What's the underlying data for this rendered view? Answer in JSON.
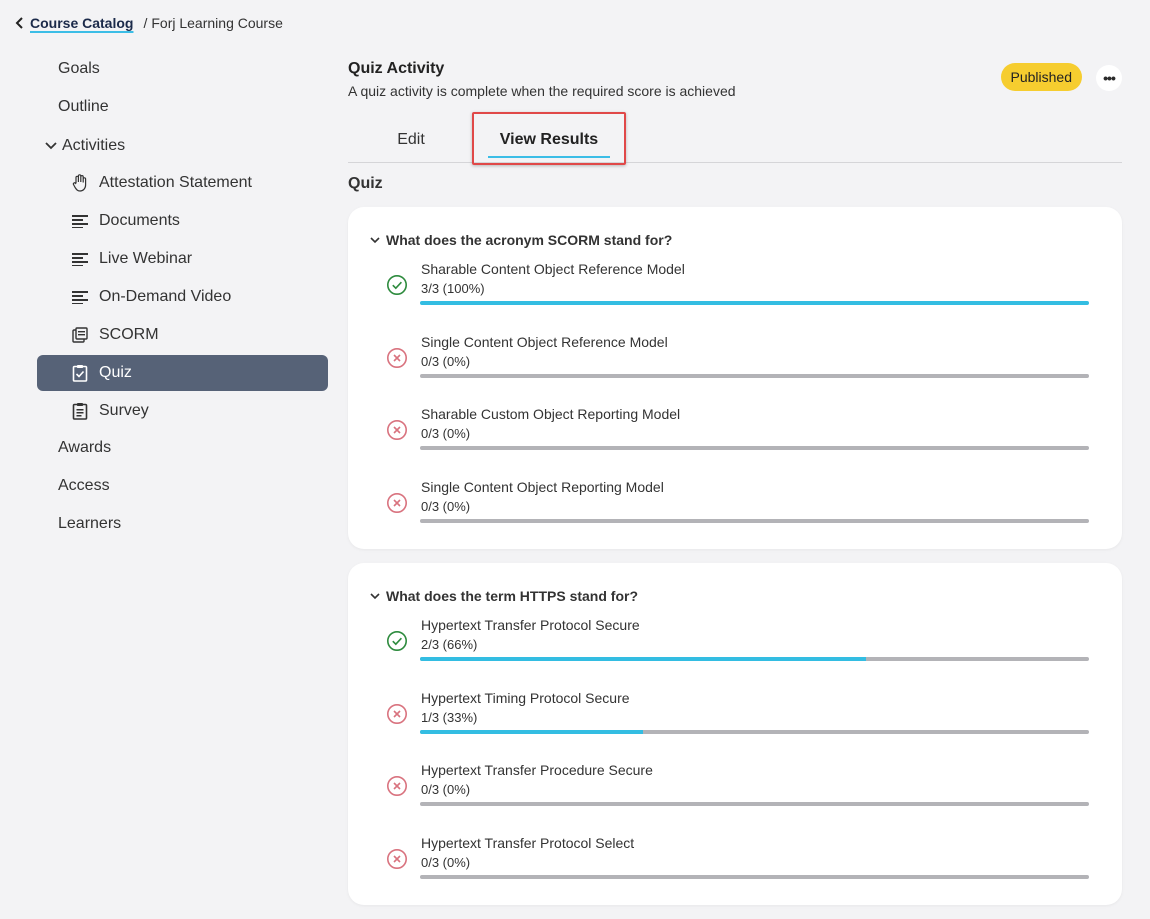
{
  "breadcrumb": {
    "link": "Course Catalog",
    "separator": "/",
    "current": "Forj Learning Course"
  },
  "sidebar": {
    "top": [
      {
        "label": "Goals"
      },
      {
        "label": "Outline"
      }
    ],
    "group": {
      "label": "Activities"
    },
    "activities": [
      {
        "label": "Attestation Statement",
        "icon": "hand-icon"
      },
      {
        "label": "Documents",
        "icon": "lines-icon"
      },
      {
        "label": "Live Webinar",
        "icon": "lines-icon"
      },
      {
        "label": "On-Demand Video",
        "icon": "lines-icon"
      },
      {
        "label": "SCORM",
        "icon": "stack-icon"
      },
      {
        "label": "Quiz",
        "icon": "clipboard-check-icon",
        "active": true
      },
      {
        "label": "Survey",
        "icon": "clipboard-list-icon"
      }
    ],
    "bottom": [
      {
        "label": "Awards"
      },
      {
        "label": "Access"
      },
      {
        "label": "Learners"
      }
    ]
  },
  "header": {
    "title": "Quiz Activity",
    "subtitle": "A quiz activity is complete when the required score is achieved",
    "status": "Published",
    "more": "•••"
  },
  "tabs": [
    {
      "label": "Edit"
    },
    {
      "label": "View Results",
      "active": true
    }
  ],
  "section_title": "Quiz",
  "questions": [
    {
      "question": "What does the acronym SCORM stand for?",
      "answers": [
        {
          "label": "Sharable Content Object Reference Model",
          "count": "3/3 (100%)",
          "correct": true,
          "fraction": 1.0
        },
        {
          "label": "Single Content Object Reference Model",
          "count": "0/3 (0%)",
          "correct": false,
          "fraction": 0
        },
        {
          "label": "Sharable Custom Object Reporting Model",
          "count": "0/3 (0%)",
          "correct": false,
          "fraction": 0
        },
        {
          "label": "Single Content Object Reporting Model",
          "count": "0/3 (0%)",
          "correct": false,
          "fraction": 0
        }
      ]
    },
    {
      "question": "What does the term HTTPS stand for?",
      "answers": [
        {
          "label": "Hypertext Transfer Protocol Secure",
          "count": "2/3 (66%)",
          "correct": true,
          "fraction": 0.667
        },
        {
          "label": "Hypertext Timing Protocol Secure",
          "count": "1/3 (33%)",
          "correct": false,
          "fraction": 0.333
        },
        {
          "label": "Hypertext Transfer Procedure Secure",
          "count": "0/3 (0%)",
          "correct": false,
          "fraction": 0
        },
        {
          "label": "Hypertext Transfer Protocol Select",
          "count": "0/3 (0%)",
          "correct": false,
          "fraction": 0
        }
      ]
    }
  ],
  "colors": {
    "accent": "#33bde2",
    "active_nav": "#566277",
    "badge": "#f6cd2f",
    "correct": "#2e8b3e",
    "incorrect": "#d9737f",
    "highlight": "#e04848"
  }
}
